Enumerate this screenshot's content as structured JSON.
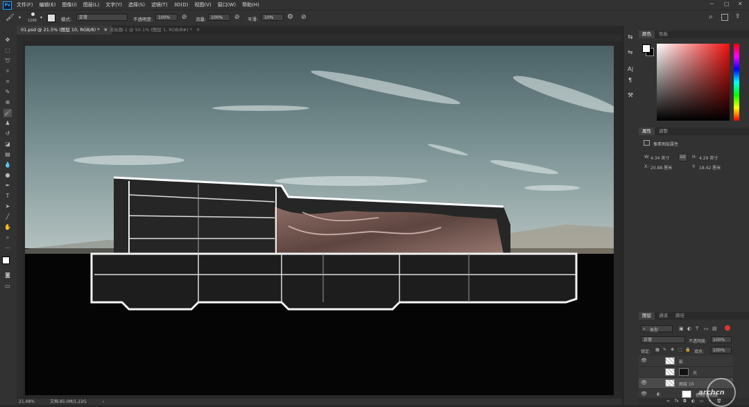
{
  "app": {
    "logo": "Ps"
  },
  "menu": [
    "文件(F)",
    "编辑(E)",
    "图像(I)",
    "图层(L)",
    "文字(Y)",
    "选择(S)",
    "滤镜(T)",
    "3D(D)",
    "视图(V)",
    "窗口(W)",
    "帮助(H)"
  ],
  "options": {
    "brush_size": "1200",
    "mode_label": "模式:",
    "mode_value": "正常",
    "opacity_label": "不透明度:",
    "opacity_value": "100%",
    "flow_label": "流量:",
    "flow_value": "100%",
    "smooth_label": "平滑:",
    "smooth_value": "10%"
  },
  "tabs": [
    {
      "label": "01.psd @ 21.5% (图层 10, RGB/8) *"
    },
    {
      "label": "未标题-1 @ 50.1% (图层 1, RGB/8#) *"
    }
  ],
  "status": {
    "zoom": "21.48%",
    "doc": "文档:85.0M/1.22G"
  },
  "color_panel": {
    "tab1": "颜色",
    "tab2": "色板"
  },
  "properties": {
    "tab1": "属性",
    "tab2": "调整",
    "title": "像素图层属性",
    "w_label": "W:",
    "w": "4.34 英寸",
    "h_label": "H:",
    "h": "4.29 英寸",
    "x_label": "X:",
    "x": "20.88 厘米",
    "y_label": "Y:",
    "y": "18.42 厘米",
    "link": "GO"
  },
  "layers": {
    "tab1": "图层",
    "tab2": "通道",
    "tab3": "路径",
    "filter": "类型",
    "blend": "正常",
    "opacity_label": "不透明度:",
    "opacity": "100%",
    "lock_label": "锁定:",
    "fill_label": "填充:",
    "fill": "100%",
    "items": [
      {
        "name": "影",
        "selected": false
      },
      {
        "name": "光",
        "selected": false
      },
      {
        "name": "图层 10",
        "selected": true
      },
      {
        "name": "色相/饱和度",
        "selected": false
      }
    ]
  },
  "watermark": "archcn"
}
